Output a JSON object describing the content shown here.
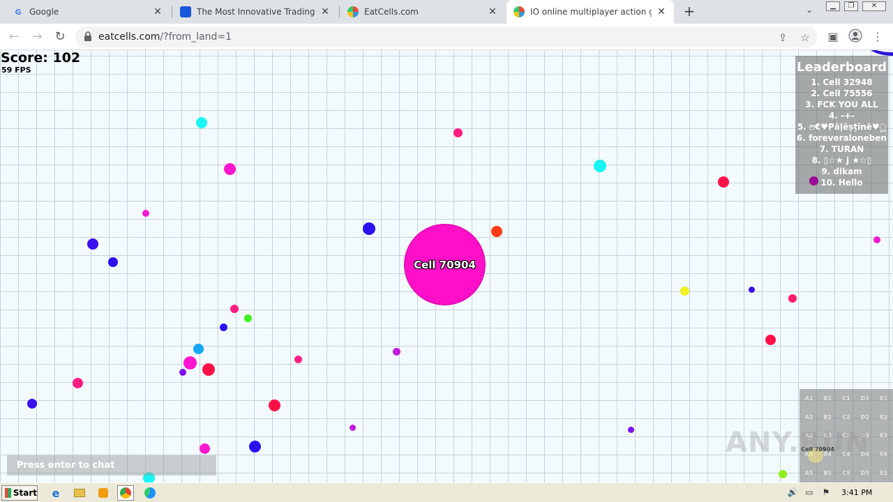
{
  "browser": {
    "tabs": [
      {
        "title": "Google",
        "favicon": "google-icon",
        "active": false
      },
      {
        "title": "The Most Innovative Trading Platform",
        "favicon": "trading-icon",
        "active": false
      },
      {
        "title": "EatCells.com",
        "favicon": "eatcells-icon",
        "active": false
      },
      {
        "title": "IO online multiplayer action game. S",
        "favicon": "eatcells-icon",
        "active": true
      }
    ],
    "new_tab_label": "+",
    "url_host": "eatcells.com",
    "url_path": "/?from_land=1"
  },
  "game": {
    "score_label": "Score: 102",
    "fps_label": "59 FPS",
    "player": {
      "name": "Cell 70904",
      "color": "#ff10c8"
    },
    "leaderboard": {
      "title": "Leaderboard",
      "entries": [
        "1. Cell 32948",
        "2. Cell 75556",
        "3. FCK YOU ALL",
        "4. -+-",
        "5. ෆ€♥Pāļēșțīnē♥ූ",
        "6. foreveraloneben",
        "7. TURAN",
        "8. ▯☆★ j ★☆▯",
        "9. dikam",
        "10. Hello"
      ]
    },
    "minimap": {
      "cells": [
        "A1",
        "B1",
        "C1",
        "D1",
        "E1",
        "A2",
        "B2",
        "C2",
        "D2",
        "E2",
        "A3",
        "B3",
        "C3",
        "D3",
        "E3",
        "A4",
        "B4",
        "C4",
        "D4",
        "E4",
        "A5",
        "B5",
        "C5",
        "D5",
        "E5"
      ],
      "player_label": "Cell 70904"
    },
    "chat_placeholder": "Press enter to chat",
    "watermark": "ANY.RUN"
  },
  "taskbar": {
    "start_label": "Start",
    "clock": "3:41 PM"
  }
}
